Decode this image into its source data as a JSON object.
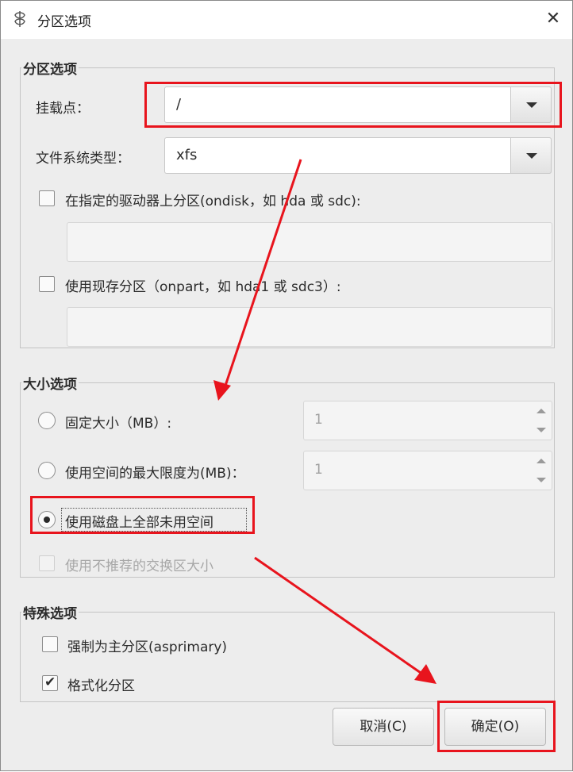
{
  "window": {
    "title": "分区选项",
    "close_glyph": "✕"
  },
  "partition_options": {
    "title": "分区选项",
    "mount_point_label": "挂载点：",
    "mount_point_value": "/",
    "fs_type_label": "文件系统类型：",
    "fs_type_value": "xfs",
    "ondisk_label": "在指定的驱动器上分区(ondisk，如 hda 或 sdc):",
    "ondisk_value": "",
    "onpart_label": "使用现存分区（onpart，如 hda1 或 sdc3）:",
    "onpart_value": ""
  },
  "size_options": {
    "title": "大小选项",
    "fixed_label": "固定大小（MB）:",
    "fixed_value": "1",
    "max_label": "使用空间的最大限度为(MB)：",
    "max_value": "1",
    "fill_label": "使用磁盘上全部未用空间",
    "fill_selected": true,
    "swap_label": "使用不推荐的交换区大小"
  },
  "special_options": {
    "title": "特殊选项",
    "primary_label": "强制为主分区(asprimary)",
    "primary_checked": false,
    "format_label": "格式化分区",
    "format_checked": true,
    "check_glyph": "✔"
  },
  "buttons": {
    "cancel": "取消(C)",
    "ok": "确定(O)"
  },
  "annotation": {
    "color": "#e8141d"
  }
}
